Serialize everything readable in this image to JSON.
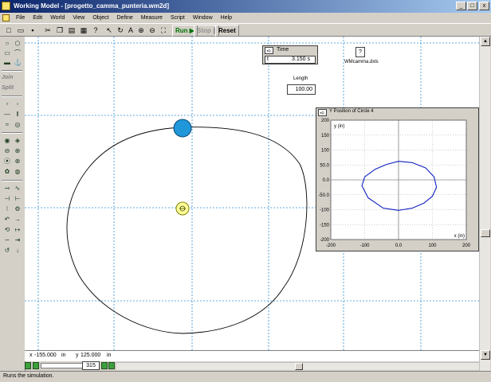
{
  "window": {
    "title": "Working Model - [progetto_camma_punteria.wm2d]",
    "minimize_label": "_",
    "maximize_label": "□",
    "close_label": "x"
  },
  "menu": [
    "File",
    "Edit",
    "World",
    "View",
    "Object",
    "Define",
    "Measure",
    "Script",
    "Window",
    "Help"
  ],
  "toolbar": {
    "run_label": "Run",
    "stop_label": "Stop",
    "reset_label": "Reset"
  },
  "palette": {
    "join_label": "Join",
    "split_label": "Split"
  },
  "time_meter": {
    "title": "Time",
    "field_label": "t",
    "value": "3.150 s"
  },
  "vector_display": {
    "value": "?",
    "label": "WMcamma.dxls"
  },
  "length_control": {
    "label": "Length",
    "value": "100.00"
  },
  "plot": {
    "title": "Y Position of Circle 4",
    "ylabel": "y (in)",
    "xlabel": "x (in)"
  },
  "chart_data": {
    "type": "line",
    "title": "Y Position of Circle 4",
    "xlabel": "x (in)",
    "ylabel": "y (in)",
    "xlim": [
      -200,
      200
    ],
    "ylim": [
      -200,
      200
    ],
    "xticks": [
      "-200",
      "-100",
      "0.0",
      "100",
      "200"
    ],
    "yticks": [
      "200",
      "150",
      "100",
      "50.0",
      "0.0",
      "-50.0",
      "-100",
      "-150",
      "-200"
    ],
    "grid": true,
    "series": [
      {
        "x": [
          0,
          40,
          80,
          105,
          112,
          100,
          75,
          40,
          0,
          -45,
          -90,
          -108,
          -100,
          -70,
          -35,
          0
        ],
        "y": [
          62,
          58,
          40,
          10,
          -25,
          -55,
          -78,
          -95,
          -102,
          -95,
          -60,
          -20,
          10,
          35,
          52,
          62
        ],
        "color": "#1020c0"
      }
    ]
  },
  "coords": {
    "x_label": "x",
    "x_value": "-155.000",
    "x_unit": "in",
    "y_label": "y",
    "y_value": "125.000",
    "y_unit": "in"
  },
  "frame_counter": "315",
  "status": "Runs the simulation.",
  "colors": {
    "titlebar": "#0a246a",
    "workspace_grid": "#3090d0",
    "follower_circle": "#1f97d9",
    "motor": "#ffff99",
    "plot_line": "#1020c0"
  },
  "icons": {
    "motor": "motor-icon",
    "follower": "circle-body-icon"
  }
}
